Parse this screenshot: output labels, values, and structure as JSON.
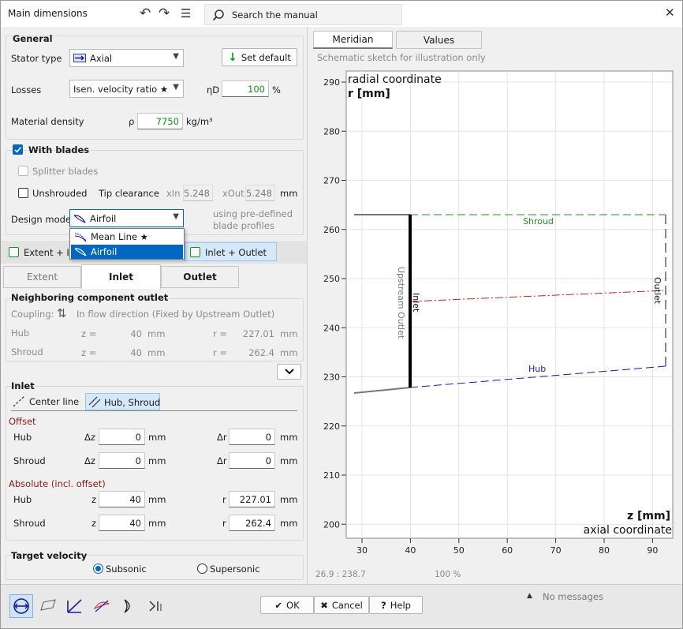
{
  "window": {
    "title": "Main dimensions",
    "search_label": "Search the manual"
  },
  "general": {
    "title": "General",
    "stator_type_label": "Stator type",
    "stator_type_value": "Axial",
    "set_default_label": "Set default",
    "losses_label": "Losses",
    "losses_value": "Isen. velocity ratio ★",
    "eta_label": "ηD",
    "eta_value": "100",
    "eta_unit": "%",
    "density_label": "Material density",
    "rho_label": "ρ",
    "rho_value": "7750",
    "rho_unit": "kg/m³"
  },
  "blades": {
    "with_blades_label": "With blades",
    "splitter_label": "Splitter blades",
    "unshrouded_label": "Unshrouded",
    "tip_clearance_label": "Tip clearance",
    "xin_label": "xIn",
    "xin_value": "5.248",
    "xout_label": "xOut",
    "xout_value": "5.248",
    "mm": "mm",
    "design_mode_label": "Design mode",
    "design_mode_value": "Airfoil",
    "design_mode_hint_1": "using pre-defined",
    "design_mode_hint_2": "blade profiles",
    "dropdown_options": [
      "Mean Line ★",
      "Airfoil"
    ]
  },
  "view_toggles": {
    "extent_inlet": "Extent + Inl",
    "inlet_outlet": "Inlet + Outlet"
  },
  "tabs": [
    "Extent",
    "Inlet",
    "Outlet"
  ],
  "neighbor": {
    "title": "Neighboring component outlet",
    "coupling_label": "Coupling:",
    "coupling_value": "In flow direction (Fixed by Upstream Outlet)",
    "hub_label": "Hub",
    "shroud_label": "Shroud",
    "z_label": "z =",
    "r_label": "r =",
    "hub_z": "40",
    "hub_r": "227.01",
    "shroud_z": "40",
    "shroud_r": "262.4",
    "mm": "mm"
  },
  "inlet": {
    "title": "Inlet",
    "center_line_label": "Center line",
    "hub_shroud_label": "Hub, Shroud",
    "offset_title": "Offset",
    "absolute_title": "Absolute (incl. offset)",
    "hub_label": "Hub",
    "shroud_label": "Shroud",
    "dz_label": "Δz",
    "dr_label": "Δr",
    "z_label": "z",
    "r_label": "r",
    "mm": "mm",
    "offset_hub_dz": "0",
    "offset_hub_dr": "0",
    "offset_shroud_dz": "0",
    "offset_shroud_dr": "0",
    "abs_hub_z": "40",
    "abs_hub_r": "227.01",
    "abs_shroud_z": "40",
    "abs_shroud_r": "262.4"
  },
  "target_velocity": {
    "title": "Target velocity",
    "subsonic": "Subsonic",
    "supersonic": "Supersonic"
  },
  "right_tabs": [
    "Meridian",
    "Values"
  ],
  "sketch_note": "Schematic sketch for illustration only",
  "plot": {
    "y_label_1": "radial coordinate",
    "y_label_2": "r [mm]",
    "x_label_1": "z [mm]",
    "x_label_2": "axial coordinate",
    "y_ticks": [
      "290",
      "280",
      "270",
      "260",
      "250",
      "240",
      "230",
      "220",
      "210",
      "200"
    ],
    "x_ticks": [
      "30",
      "40",
      "50",
      "60",
      "70",
      "80",
      "90"
    ],
    "shroud_label": "Shroud",
    "hub_label": "Hub",
    "inlet_label": "Inlet",
    "outlet_label": "Outlet",
    "upstream_label": "Upstream Outlet",
    "coord_readout": "26.9 : 238.7",
    "zoom": "100 %"
  },
  "footer": {
    "messages": "No messages",
    "ok": "OK",
    "cancel": "Cancel",
    "help": "Help"
  },
  "colors": {
    "accent": "#0067c0",
    "shroud": "#2a8a2a",
    "hub": "#1a1aa8",
    "mid": "#cc2020"
  }
}
